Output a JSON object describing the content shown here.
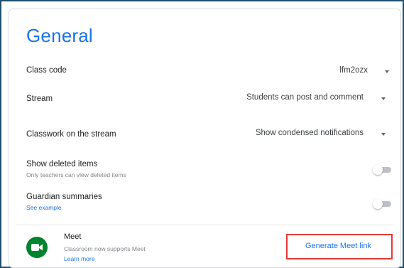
{
  "section": {
    "title": "General"
  },
  "settings": {
    "class_code": {
      "label": "Class code",
      "value": "lfm2ozx"
    },
    "stream": {
      "label": "Stream",
      "value": "Students can post and comment"
    },
    "classwork_on_stream": {
      "label": "Classwork on the stream",
      "value": "Show condensed notifications"
    },
    "show_deleted_items": {
      "label": "Show deleted items",
      "sublabel": "Only teachers can view deleted items",
      "enabled": false
    },
    "guardian_summaries": {
      "label": "Guardian summaries",
      "link": "See example",
      "enabled": false
    }
  },
  "meet": {
    "title": "Meet",
    "subtitle": "Classroom now supports Meet",
    "learn_more": "Learn more",
    "button_label": "Generate Meet link",
    "icon": "google-meet-icon"
  },
  "colors": {
    "accent": "#1a73e8",
    "highlight": "#e53935",
    "meet_green": "#00832d"
  }
}
